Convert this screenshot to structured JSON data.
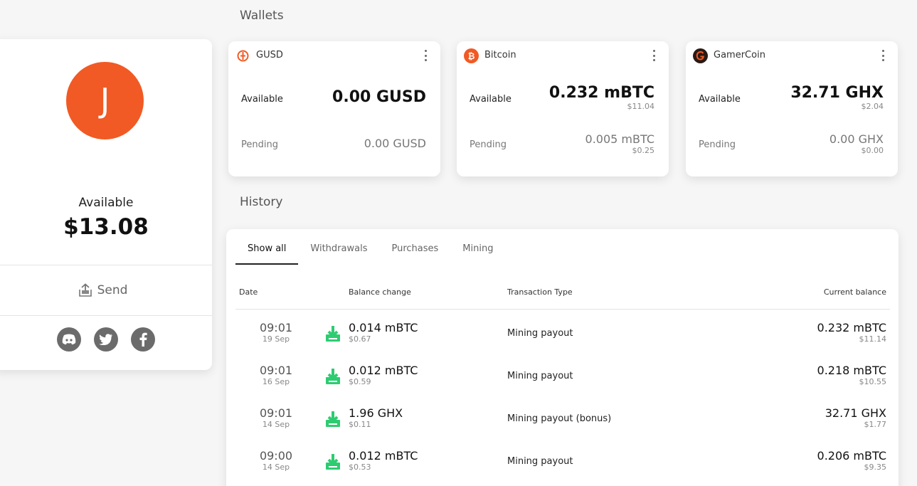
{
  "profile": {
    "avatar_letter": "J",
    "available_label": "Available",
    "available_value": "$13.08",
    "send_label": "Send",
    "social": [
      "discord-icon",
      "twitter-icon",
      "facebook-icon"
    ]
  },
  "wallets_title": "Wallets",
  "wallets": [
    {
      "name": "GUSD",
      "icon": "gusd-icon",
      "available_label": "Available",
      "available": "0.00 GUSD",
      "available_usd": "",
      "pending_label": "Pending",
      "pending": "0.00 GUSD",
      "pending_usd": ""
    },
    {
      "name": "Bitcoin",
      "icon": "bitcoin-icon",
      "available_label": "Available",
      "available": "0.232 mBTC",
      "available_usd": "$11.04",
      "pending_label": "Pending",
      "pending": "0.005 mBTC",
      "pending_usd": "$0.25"
    },
    {
      "name": "GamerCoin",
      "icon": "gamercoin-icon",
      "available_label": "Available",
      "available": "32.71 GHX",
      "available_usd": "$2.04",
      "pending_label": "Pending",
      "pending": "0.00 GHX",
      "pending_usd": "$0.00"
    }
  ],
  "history_title": "History",
  "history": {
    "tabs": [
      "Show all",
      "Withdrawals",
      "Purchases",
      "Mining"
    ],
    "active_tab": "Show all",
    "columns": {
      "date": "Date",
      "change": "Balance change",
      "type": "Transaction Type",
      "balance": "Current balance"
    },
    "rows": [
      {
        "time": "09:01",
        "date": "19 Sep",
        "change": "0.014 mBTC",
        "change_usd": "$0.67",
        "type": "Mining payout",
        "balance": "0.232 mBTC",
        "balance_usd": "$11.14"
      },
      {
        "time": "09:01",
        "date": "16 Sep",
        "change": "0.012 mBTC",
        "change_usd": "$0.59",
        "type": "Mining payout",
        "balance": "0.218 mBTC",
        "balance_usd": "$10.55"
      },
      {
        "time": "09:01",
        "date": "14 Sep",
        "change": "1.96 GHX",
        "change_usd": "$0.11",
        "type": "Mining payout (bonus)",
        "balance": "32.71 GHX",
        "balance_usd": "$1.77"
      },
      {
        "time": "09:00",
        "date": "14 Sep",
        "change": "0.012 mBTC",
        "change_usd": "$0.53",
        "type": "Mining payout",
        "balance": "0.206 mBTC",
        "balance_usd": "$9.35"
      }
    ]
  },
  "colors": {
    "accent": "#f15a24",
    "download_green": "#2ecc71"
  }
}
